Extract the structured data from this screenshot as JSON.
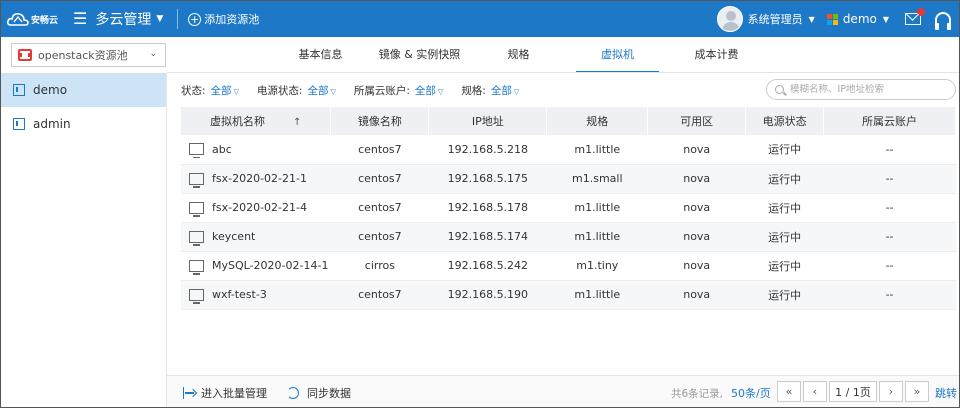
{
  "header": {
    "logo_text": "安畅云",
    "app_title": "多云管理",
    "add_pool_label": "添加资源池",
    "user_name": "系统管理员",
    "project_name": "demo",
    "ms_colors": [
      "#f25022",
      "#7fba00",
      "#00a4ef",
      "#ffb900"
    ]
  },
  "pool_select": {
    "label": "openstack资源池"
  },
  "tabs": [
    {
      "label": "基本信息",
      "active": false
    },
    {
      "label": "镜像 & 实例快照",
      "active": false
    },
    {
      "label": "规格",
      "active": false
    },
    {
      "label": "虚拟机",
      "active": true
    },
    {
      "label": "成本计费",
      "active": false
    }
  ],
  "sidebar": {
    "items": [
      {
        "label": "demo",
        "active": true
      },
      {
        "label": "admin",
        "active": false
      }
    ]
  },
  "filters": [
    {
      "label": "状态:",
      "value": "全部"
    },
    {
      "label": "电源状态:",
      "value": "全部"
    },
    {
      "label": "所属云账户:",
      "value": "全部"
    },
    {
      "label": "规格:",
      "value": "全部"
    }
  ],
  "search": {
    "placeholder": "模糊名称、IP地址检索"
  },
  "table": {
    "sort_indicator": "↑",
    "columns": [
      "虚拟机名称",
      "镜像名称",
      "IP地址",
      "规格",
      "可用区",
      "电源状态",
      "所属云账户"
    ],
    "rows": [
      [
        "abc",
        "centos7",
        "192.168.5.218",
        "m1.little",
        "nova",
        "运行中",
        "--"
      ],
      [
        "fsx-2020-02-21-1",
        "centos7",
        "192.168.5.175",
        "m1.small",
        "nova",
        "运行中",
        "--"
      ],
      [
        "fsx-2020-02-21-4",
        "centos7",
        "192.168.5.178",
        "m1.little",
        "nova",
        "运行中",
        "--"
      ],
      [
        "keycent",
        "centos7",
        "192.168.5.174",
        "m1.little",
        "nova",
        "运行中",
        "--"
      ],
      [
        "MySQL-2020-02-14-1",
        "cirros",
        "192.168.5.242",
        "m1.tiny",
        "nova",
        "运行中",
        "--"
      ],
      [
        "wxf-test-3",
        "centos7",
        "192.168.5.190",
        "m1.little",
        "nova",
        "运行中",
        "--"
      ]
    ]
  },
  "footer": {
    "batch_label": "进入批量管理",
    "sync_label": "同步数据",
    "total_text": "共6条记录,",
    "page_size": "50条/页",
    "first": "«",
    "prev": "‹",
    "page_indicator": "1 / 1页",
    "next": "›",
    "last": "»",
    "jump_label": "跳转"
  }
}
